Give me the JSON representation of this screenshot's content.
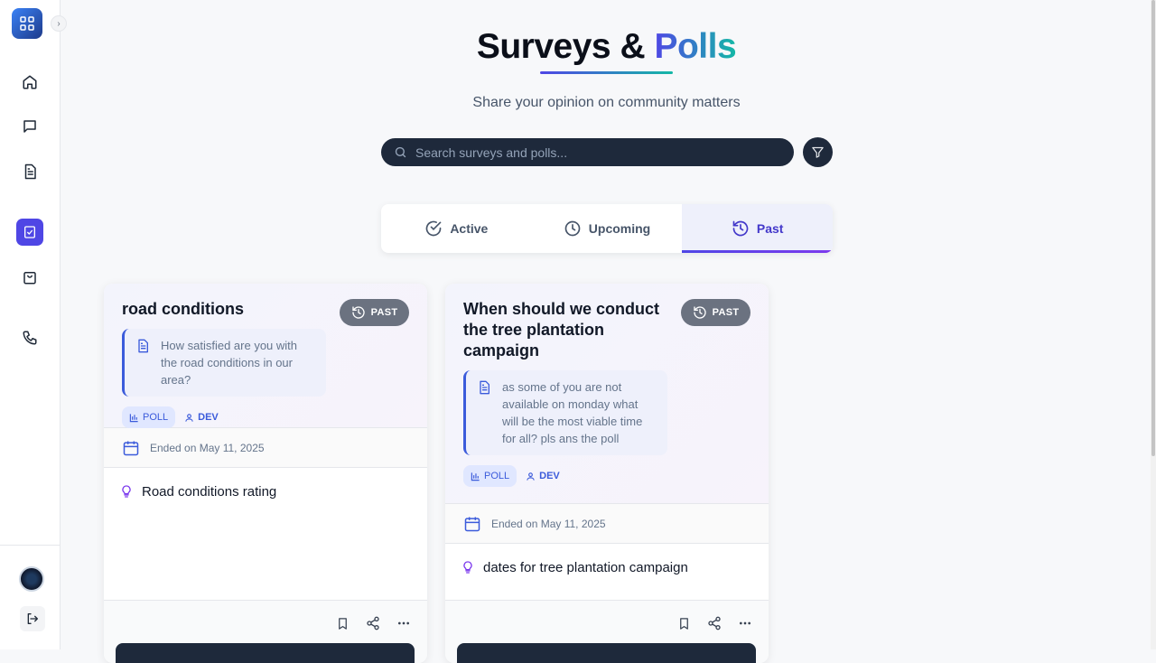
{
  "header": {
    "title_main": "Surveys & ",
    "title_accent": "Polls",
    "subtitle": "Share your opinion on community matters"
  },
  "search": {
    "placeholder": "Search surveys and polls..."
  },
  "tabs": [
    {
      "label": "Active",
      "icon": "check-circle-icon"
    },
    {
      "label": "Upcoming",
      "icon": "clock-icon"
    },
    {
      "label": "Past",
      "icon": "history-icon",
      "active": true
    }
  ],
  "cards": [
    {
      "title": "road conditions",
      "status": "PAST",
      "description": "How satisfied are you with the road conditions in our area?",
      "type": "POLL",
      "author": "DEV",
      "ended": "Ended on May 11, 2025",
      "question": "Road conditions rating"
    },
    {
      "title": "When should we conduct the tree plantation campaign",
      "status": "PAST",
      "description": "as some of you are not available on monday what will be the most viable time for all? pls ans the poll",
      "type": "POLL",
      "author": "DEV",
      "ended": "Ended on May 11, 2025",
      "question": "dates for tree plantation campaign"
    }
  ],
  "colors": {
    "accent": "#4f46e5",
    "accent2": "#14b8a6",
    "dark": "#1e293b"
  }
}
